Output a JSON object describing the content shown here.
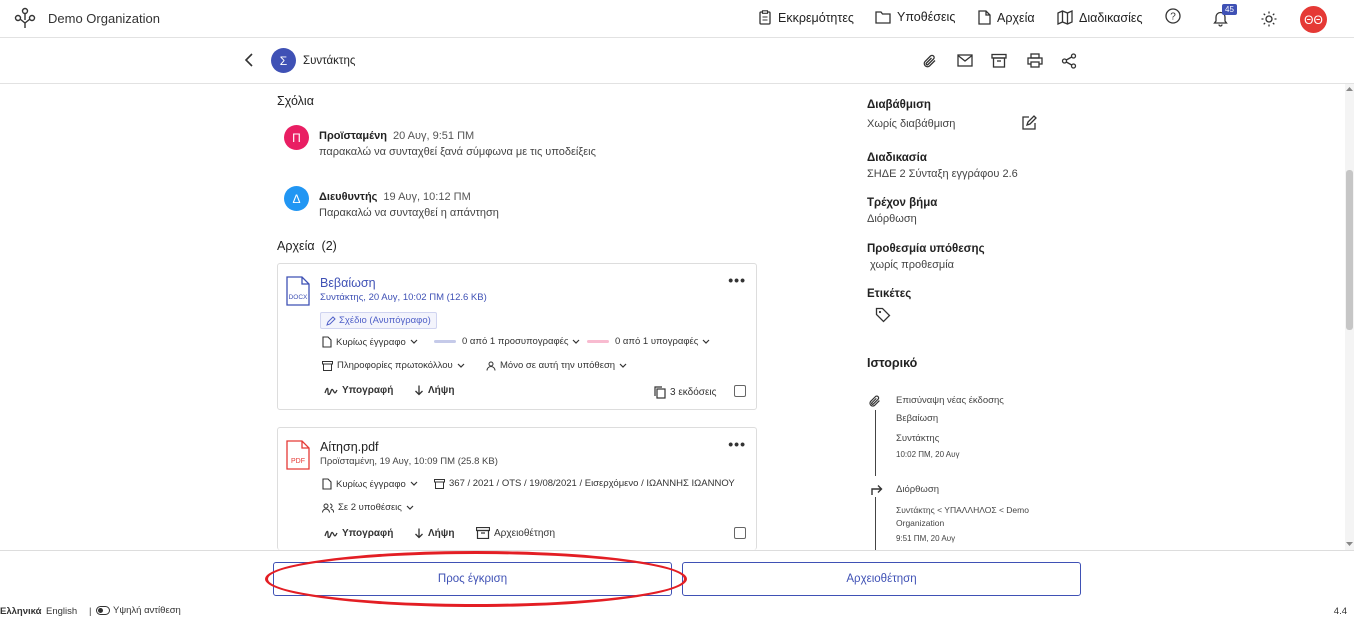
{
  "header": {
    "org_name": "Demo Organization",
    "nav": [
      "Εκκρεμότητες",
      "Υποθέσεις",
      "Αρχεία",
      "Διαδικασίες"
    ],
    "notification_count": "45",
    "user_initials": "ΘΘ"
  },
  "subject": {
    "avatar_letter": "Σ",
    "title": "Συντάκτης"
  },
  "comments": {
    "title": "Σχόλια",
    "items": [
      {
        "initial": "Π",
        "author": "Προϊσταμένη",
        "time": "20 Αυγ, 9:51 ΠΜ",
        "text": "παρακαλώ να συνταχθεί ξανά σύμφωνα με τις υποδείξεις",
        "color": "#e91e63"
      },
      {
        "initial": "Δ",
        "author": "Διευθυντής",
        "time": "19 Αυγ, 10:12 ΠΜ",
        "text": "Παρακαλώ να συνταχθεί η απάντηση",
        "color": "#2196f3"
      }
    ]
  },
  "files": {
    "title": "Αρχεία",
    "count": "(2)",
    "items": [
      {
        "type_label": "DOCX",
        "name": "Βεβαίωση",
        "meta": "Συντάκτης,  20 Αυγ, 10:02 ΠΜ (12.6 KB)",
        "draft": "Σχέδιο (Ανυπόγραφο)",
        "main_doc": "Κυρίως έγγραφο",
        "pre_sign": "0 από 1 προσυπογραφές",
        "sign": "0 από 1 υπογραφές",
        "protocol": "Πληροφορίες πρωτοκόλλου",
        "scope": "Μόνο σε αυτή την υπόθεση",
        "sign_action": "Υπογραφή",
        "download_action": "Λήψη",
        "versions": "3 εκδόσεις"
      },
      {
        "type_label": "PDF",
        "name": "Αίτηση.pdf",
        "meta": "Προϊσταμένη,  19 Αυγ, 10:09 ΠΜ (25.8 KB)",
        "main_doc": "Κυρίως έγγραφο",
        "protocol_info": "367 / 2021 / OTS / 19/08/2021 / Εισερχόμενο / ΙΩΑΝΝΗΣ ΙΩΑΝΝΟΥ",
        "scope": "Σε 2 υποθέσεις",
        "sign_action": "Υπογραφή",
        "download_action": "Λήψη",
        "archive_action": "Αρχειοθέτηση"
      }
    ]
  },
  "details": {
    "classification_label": "Διαβάθμιση",
    "classification_value": "Χωρίς διαβάθμιση",
    "process_label": "Διαδικασία",
    "process_value": "ΣΗΔΕ 2 Σύνταξη εγγράφου 2.6",
    "step_label": "Τρέχον βήμα",
    "step_value": "Διόρθωση",
    "deadline_label": "Προθεσμία υπόθεσης",
    "deadline_value": "χωρίς προθεσμία",
    "tags_label": "Ετικέτες"
  },
  "history": {
    "title": "Ιστορικό",
    "items": [
      {
        "action": "Επισύναψη νέας έκδοσης",
        "detail": "Βεβαίωση",
        "actor": "Συντάκτης",
        "time": "10:02 ΠΜ, 20 Αυγ"
      },
      {
        "action": "Διόρθωση",
        "actor_line1": "Συντάκτης < ΥΠΑΛΛΗΛΟΣ < Demo",
        "actor_line2": "Organization",
        "time": "9:51 ΠΜ, 20 Αυγ"
      }
    ]
  },
  "buttons": {
    "approve": "Προς έγκριση",
    "archive": "Αρχειοθέτηση"
  },
  "footer": {
    "lang_el": "Ελληνικά",
    "lang_en": "English",
    "separator": "|",
    "contrast": "Υψηλή αντίθεση",
    "version": "4.4"
  },
  "colors": {
    "primary": "#3f51b5",
    "annotation": "#e31e24"
  }
}
